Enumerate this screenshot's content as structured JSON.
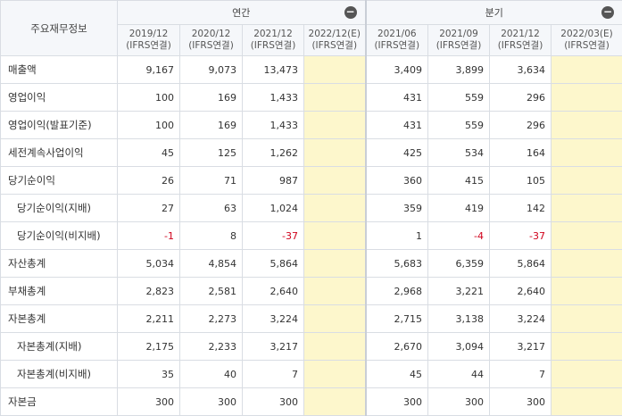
{
  "header": {
    "title": "주요재무정보",
    "annual_label": "연간",
    "quarter_label": "분기",
    "collapse_symbol": "−",
    "annual_columns": [
      {
        "period": "2019/12",
        "basis": "(IFRS연결)"
      },
      {
        "period": "2020/12",
        "basis": "(IFRS연결)"
      },
      {
        "period": "2021/12",
        "basis": "(IFRS연결)"
      },
      {
        "period": "2022/12(E)",
        "basis": "(IFRS연결)"
      }
    ],
    "quarter_columns": [
      {
        "period": "2021/06",
        "basis": "(IFRS연결)"
      },
      {
        "period": "2021/09",
        "basis": "(IFRS연결)"
      },
      {
        "period": "2021/12",
        "basis": "(IFRS연결)"
      },
      {
        "period": "2022/03(E)",
        "basis": "(IFRS연결)"
      }
    ]
  },
  "rows": [
    {
      "label": "매출액",
      "annual": [
        "9,167",
        "9,073",
        "13,473",
        ""
      ],
      "quarter": [
        "3,409",
        "3,899",
        "3,634",
        ""
      ]
    },
    {
      "label": "영업이익",
      "annual": [
        "100",
        "169",
        "1,433",
        ""
      ],
      "quarter": [
        "431",
        "559",
        "296",
        ""
      ]
    },
    {
      "label": "영업이익(발표기준)",
      "annual": [
        "100",
        "169",
        "1,433",
        ""
      ],
      "quarter": [
        "431",
        "559",
        "296",
        ""
      ]
    },
    {
      "label": "세전계속사업이익",
      "annual": [
        "45",
        "125",
        "1,262",
        ""
      ],
      "quarter": [
        "425",
        "534",
        "164",
        ""
      ]
    },
    {
      "label": "당기순이익",
      "annual": [
        "26",
        "71",
        "987",
        ""
      ],
      "quarter": [
        "360",
        "415",
        "105",
        ""
      ]
    },
    {
      "label": "당기순이익(지배)",
      "annual": [
        "27",
        "63",
        "1,024",
        ""
      ],
      "quarter": [
        "359",
        "419",
        "142",
        ""
      ]
    },
    {
      "label": "당기순이익(비지배)",
      "annual": [
        "-1",
        "8",
        "-37",
        ""
      ],
      "quarter": [
        "1",
        "-4",
        "-37",
        ""
      ]
    },
    {
      "label": "자산총계",
      "annual": [
        "5,034",
        "4,854",
        "5,864",
        ""
      ],
      "quarter": [
        "5,683",
        "6,359",
        "5,864",
        ""
      ]
    },
    {
      "label": "부채총계",
      "annual": [
        "2,823",
        "2,581",
        "2,640",
        ""
      ],
      "quarter": [
        "2,968",
        "3,221",
        "2,640",
        ""
      ]
    },
    {
      "label": "자본총계",
      "annual": [
        "2,211",
        "2,273",
        "3,224",
        ""
      ],
      "quarter": [
        "2,715",
        "3,138",
        "3,224",
        ""
      ]
    },
    {
      "label": "자본총계(지배)",
      "annual": [
        "2,175",
        "2,233",
        "3,217",
        ""
      ],
      "quarter": [
        "2,670",
        "3,094",
        "3,217",
        ""
      ]
    },
    {
      "label": "자본총계(비지배)",
      "annual": [
        "35",
        "40",
        "7",
        ""
      ],
      "quarter": [
        "45",
        "44",
        "7",
        ""
      ]
    },
    {
      "label": "자본금",
      "annual": [
        "300",
        "300",
        "300",
        ""
      ],
      "quarter": [
        "300",
        "300",
        "300",
        ""
      ]
    }
  ]
}
